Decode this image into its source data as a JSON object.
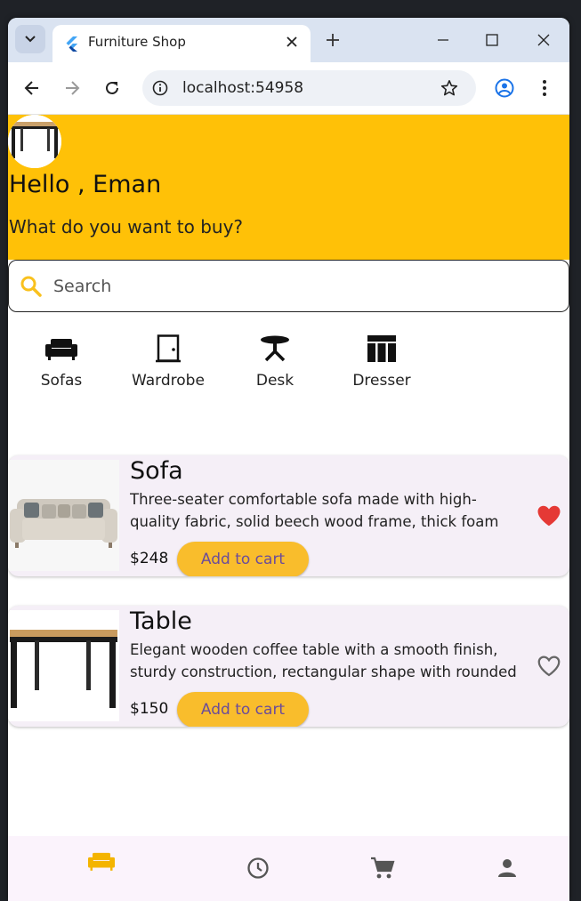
{
  "browser": {
    "tab_title": "Furniture Shop",
    "url": "localhost:54958"
  },
  "header": {
    "greeting": "Hello , Eman",
    "prompt": "What do you want to buy?"
  },
  "search": {
    "placeholder": "Search"
  },
  "categories": [
    {
      "label": "Sofas",
      "icon": "sofa-icon"
    },
    {
      "label": "Wardrobe",
      "icon": "door-icon"
    },
    {
      "label": "Desk",
      "icon": "table-icon"
    },
    {
      "label": "Dresser",
      "icon": "dresser-icon"
    }
  ],
  "products": [
    {
      "title": "Sofa",
      "description": "Three-seater comfortable sofa made with high-quality fabric, solid beech wood frame, thick foam cushions,",
      "price": "$248",
      "button_label": "Add to cart",
      "favorite": true
    },
    {
      "title": "Table",
      "description": "Elegant wooden coffee table with a smooth finish, sturdy construction, rectangular shape with rounded",
      "price": "$150",
      "button_label": "Add to cart",
      "favorite": false
    }
  ],
  "bottom_nav": [
    {
      "icon": "sofa-icon",
      "active": true
    },
    {
      "icon": "history-icon",
      "active": false
    },
    {
      "icon": "cart-icon",
      "active": false
    },
    {
      "icon": "person-icon",
      "active": false
    }
  ],
  "colors": {
    "accent": "#ffc107",
    "button": "#f9bd2c",
    "button_text": "#6b4c9a",
    "favorite": "#e53935",
    "nav_active": "#f4b400"
  }
}
